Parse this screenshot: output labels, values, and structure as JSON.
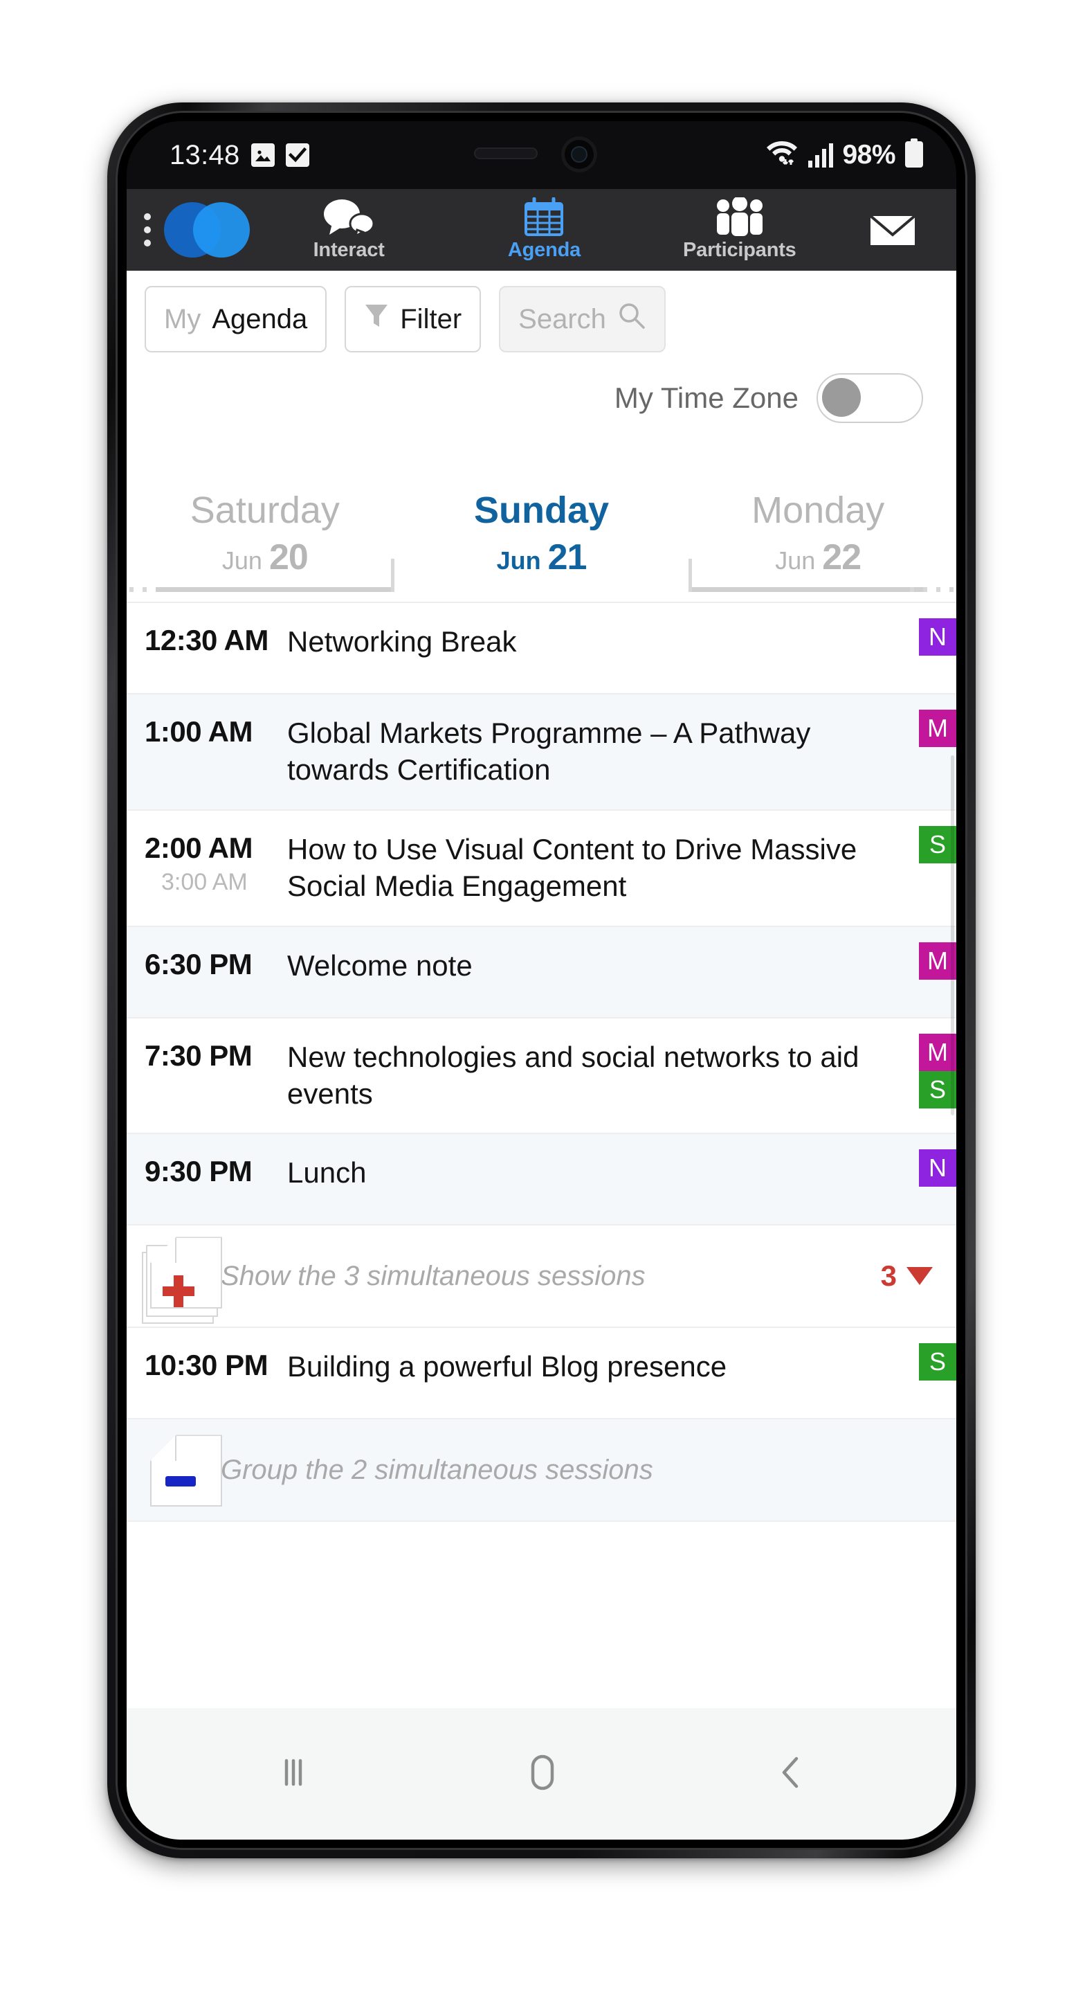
{
  "status_bar": {
    "clock": "13:48",
    "icons": [
      "image-icon",
      "checkbox-icon",
      "wifi-icon",
      "signal-icon"
    ],
    "battery_percent": "98%"
  },
  "app_nav": {
    "menu_icon": "kebab-menu-icon",
    "logo": "brand-logo",
    "items": [
      {
        "label": "Interact",
        "icon": "chat-bubbles-icon",
        "active": false
      },
      {
        "label": "Agenda",
        "icon": "calendar-icon",
        "active": true
      },
      {
        "label": "Participants",
        "icon": "people-icon",
        "active": false
      }
    ],
    "mail_icon": "envelope-icon",
    "active_color": "#49a0f5"
  },
  "filter_bar": {
    "my_agenda_prefix": "My ",
    "my_agenda_label": "Agenda",
    "filter_label": "Filter",
    "filter_icon": "funnel-icon",
    "search_placeholder": "Search",
    "search_value": "",
    "search_icon": "magnifier-icon"
  },
  "time_zone": {
    "label": "My Time Zone",
    "enabled": false
  },
  "days": [
    {
      "name": "Saturday",
      "month": "Jun",
      "day": "20",
      "active": false
    },
    {
      "name": "Sunday",
      "month": "Jun",
      "day": "21",
      "active": true
    },
    {
      "name": "Monday",
      "month": "Jun",
      "day": "22",
      "active": false
    }
  ],
  "agenda": {
    "rows": [
      {
        "kind": "session",
        "start": "12:30 AM",
        "end": "",
        "title": "Networking Break",
        "badges": [
          "N"
        ],
        "shaded": false
      },
      {
        "kind": "session",
        "start": "1:00 AM",
        "end": "",
        "title": "Global Markets Programme – A Pathway towards Certification",
        "badges": [
          "M"
        ],
        "shaded": true
      },
      {
        "kind": "session",
        "start": "2:00 AM",
        "end": "3:00 AM",
        "title": "How to Use Visual Content to Drive Massive Social Media Engagement",
        "badges": [
          "S"
        ],
        "shaded": false
      },
      {
        "kind": "session",
        "start": "6:30 PM",
        "end": "",
        "title": "Welcome note",
        "badges": [
          "M"
        ],
        "shaded": true
      },
      {
        "kind": "session",
        "start": "7:30 PM",
        "end": "",
        "title": "New technologies and social networks to aid events",
        "badges": [
          "M",
          "S"
        ],
        "shaded": false
      },
      {
        "kind": "session",
        "start": "9:30 PM",
        "end": "",
        "title": "Lunch",
        "badges": [
          "N"
        ],
        "shaded": true
      },
      {
        "kind": "expand",
        "text": "Show the 3 simultaneous sessions",
        "count": "3",
        "icon": "stacked-cards-plus-icon",
        "shaded": false
      },
      {
        "kind": "session",
        "start": "10:30 PM",
        "end": "",
        "title": "Building a powerful Blog presence",
        "badges": [
          "S"
        ],
        "shaded": false
      },
      {
        "kind": "collapse",
        "text": "Group the 2 simultaneous sessions",
        "count": "",
        "icon": "card-minus-icon",
        "shaded": true
      }
    ],
    "badge_colors": {
      "N": "#8e24e0",
      "M": "#c2179b",
      "S": "#29a128"
    }
  },
  "android_nav": {
    "recents_icon": "recents-icon",
    "home_icon": "home-icon",
    "back_icon": "back-icon"
  }
}
